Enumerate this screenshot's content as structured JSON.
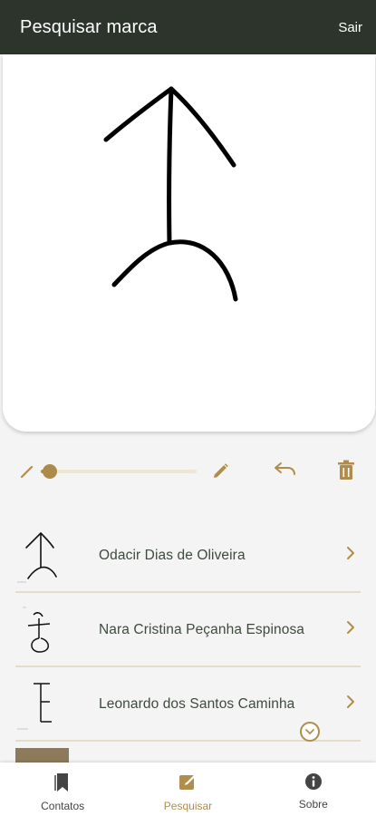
{
  "appbar": {
    "title": "Pesquisar marca",
    "action_label": "Sair"
  },
  "drawing_toolbar": {
    "icons": [
      "pencil-small-icon",
      "pencil-large-icon",
      "undo-icon",
      "trash-icon"
    ],
    "stroke_width_fraction": 0.06
  },
  "results": [
    {
      "name": "Odacir Dias de Oliveira"
    },
    {
      "name": "Nara Cristina Peçanha Espinosa"
    },
    {
      "name": "Leonardo dos Santos Caminha"
    }
  ],
  "bottom_nav": {
    "items": [
      {
        "label": "Contatos",
        "icon": "contacts-bookmark-icon"
      },
      {
        "label": "Pesquisar",
        "icon": "search-draw-icon",
        "active": true
      },
      {
        "label": "Sobre",
        "icon": "info-icon"
      }
    ]
  },
  "colors": {
    "appbar": "#2c342c",
    "accent": "#b08d4c",
    "text_dark": "#3d4a3d",
    "nav_inactive": "#444444"
  }
}
